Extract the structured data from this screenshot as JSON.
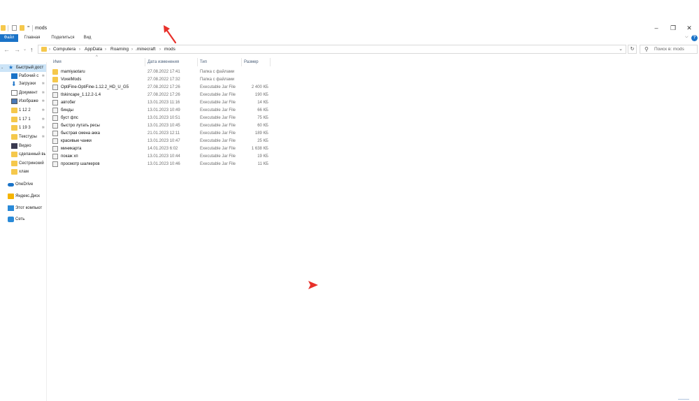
{
  "window": {
    "title": "mods",
    "controls": {
      "minimize": "–",
      "maximize": "❐",
      "close": "✕"
    }
  },
  "ribbon": {
    "tabs": [
      "Файл",
      "Главная",
      "Поделиться",
      "Вид"
    ],
    "expand": "⌵",
    "help": "?"
  },
  "address": {
    "back": "←",
    "forward": "→",
    "recent": "⌄",
    "up": "↑",
    "crumbs": [
      "Computera",
      "AppData",
      "Roaming",
      ".minecraft",
      "mods"
    ],
    "separator": "›",
    "dropdown": "⌄",
    "refresh": "↻",
    "search_placeholder": "Поиск в: mods"
  },
  "columns": {
    "name": "Имя",
    "date": "Дата изменения",
    "type": "Тип",
    "size": "Размер",
    "sort_indicator": "^"
  },
  "files": [
    {
      "name": "mamiyaotaru",
      "date": "27.08.2022 17:41",
      "type": "Папка с файлами",
      "size": "",
      "kind": "folder"
    },
    {
      "name": "VoxelMods",
      "date": "27.08.2022 17:32",
      "type": "Папка с файлами",
      "size": "",
      "kind": "folder"
    },
    {
      "name": "OptiFine-OptiFine-1.12.2_HD_U_G5",
      "date": "27.08.2022 17:26",
      "type": "Executable Jar File",
      "size": "2 400 КБ",
      "kind": "jar"
    },
    {
      "name": "tlskincape_1.12.2-1.4",
      "date": "27.08.2022 17:26",
      "type": "Executable Jar File",
      "size": "190 КБ",
      "kind": "jar"
    },
    {
      "name": "автобег",
      "date": "13.01.2023 11:16",
      "type": "Executable Jar File",
      "size": "14 КБ",
      "kind": "jar"
    },
    {
      "name": "бинды",
      "date": "13.01.2023 10:49",
      "type": "Executable Jar File",
      "size": "66 КБ",
      "kind": "jar"
    },
    {
      "name": "буст фпс",
      "date": "13.01.2023 10:51",
      "type": "Executable Jar File",
      "size": "75 КБ",
      "kind": "jar"
    },
    {
      "name": "быстро лутать ресы",
      "date": "13.01.2023 10:45",
      "type": "Executable Jar File",
      "size": "60 КБ",
      "kind": "jar"
    },
    {
      "name": "быстрая смена акка",
      "date": "21.01.2023 12:11",
      "type": "Executable Jar File",
      "size": "189 КБ",
      "kind": "jar"
    },
    {
      "name": "красивые чанки",
      "date": "13.01.2023 10:47",
      "type": "Executable Jar File",
      "size": "25 КБ",
      "kind": "jar"
    },
    {
      "name": "миникарта",
      "date": "14.01.2023 6:02",
      "type": "Executable Jar File",
      "size": "1 638 КБ",
      "kind": "jar"
    },
    {
      "name": "покаж хп",
      "date": "13.01.2023 10:44",
      "type": "Executable Jar File",
      "size": "19 КБ",
      "kind": "jar"
    },
    {
      "name": "просмотр шалкеров",
      "date": "13.01.2023 10:46",
      "type": "Executable Jar File",
      "size": "11 КБ",
      "kind": "jar"
    }
  ],
  "sidebar": {
    "quick_access": "Быстрый дост",
    "items": [
      {
        "label": "Рабочий с",
        "icon": "desktop-icon"
      },
      {
        "label": "Загрузки",
        "icon": "download-icon"
      },
      {
        "label": "Документ",
        "icon": "document-icon"
      },
      {
        "label": "Изображе",
        "icon": "pictures-icon"
      },
      {
        "label": "1 12 2",
        "icon": "folder-icon"
      },
      {
        "label": "1 17 1",
        "icon": "folder-icon"
      },
      {
        "label": "1 19 3",
        "icon": "folder-icon"
      },
      {
        "label": "Текстуры",
        "icon": "folder-icon"
      },
      {
        "label": "Видео",
        "icon": "video-icon"
      },
      {
        "label": "сделанный вы",
        "icon": "folder-icon"
      },
      {
        "label": "Сестринский",
        "icon": "folder-icon"
      },
      {
        "label": "хлам",
        "icon": "folder-icon"
      }
    ],
    "onedrive": "OneDrive",
    "yandex": "Яндекс.Диск",
    "this_pc": "Этот компьют",
    "network": "Сеть",
    "pin": "✲"
  },
  "colors": {
    "accent": "#1a73c8",
    "folder": "#f5c84c",
    "annotation": "#e8302a"
  }
}
